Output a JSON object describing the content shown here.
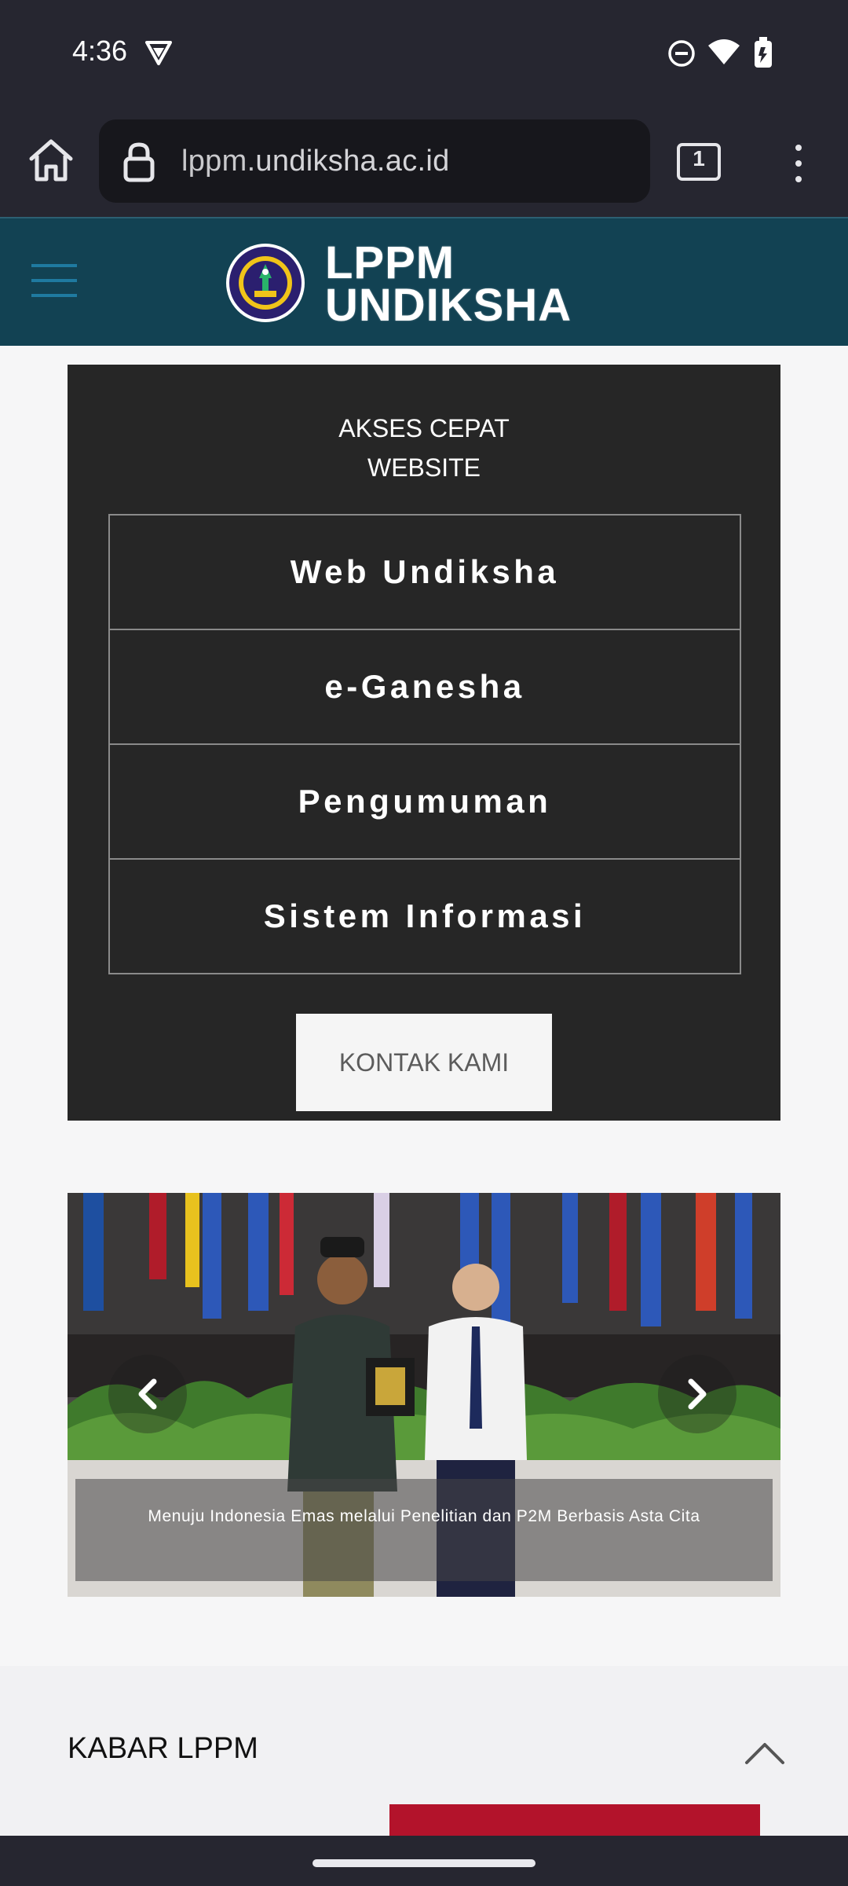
{
  "status_bar": {
    "time": "4:36",
    "icons": [
      "vpn-icon",
      "do-not-disturb-icon",
      "wifi-icon",
      "battery-icon"
    ]
  },
  "browser": {
    "url_host": "lppm.",
    "url_domain": "undiksha.ac.id",
    "tab_count": "1",
    "icons": [
      "home-icon",
      "lock-icon",
      "tabs-icon",
      "more-vert-icon"
    ]
  },
  "site_header": {
    "logo_line1": "LPPM",
    "logo_line2": "UNDIKSHA",
    "colors": {
      "header_bg": "#124253",
      "hamburger": "#1f7aa0"
    }
  },
  "akses_cepat": {
    "title_line1": "AKSES CEPAT",
    "title_line2": "WEBSITE",
    "links": [
      {
        "label": "Web Undiksha"
      },
      {
        "label": "e-Ganesha"
      },
      {
        "label": "Pengumuman"
      },
      {
        "label": "Sistem Informasi"
      }
    ],
    "kontak_label": "KONTAK KAMI"
  },
  "slider": {
    "caption": "Menuju Indonesia Emas melalui Penelitian dan P2M Berbasis Asta Cita"
  },
  "kabar": {
    "title": "KABAR LPPM",
    "accent_color": "#b3132b"
  }
}
